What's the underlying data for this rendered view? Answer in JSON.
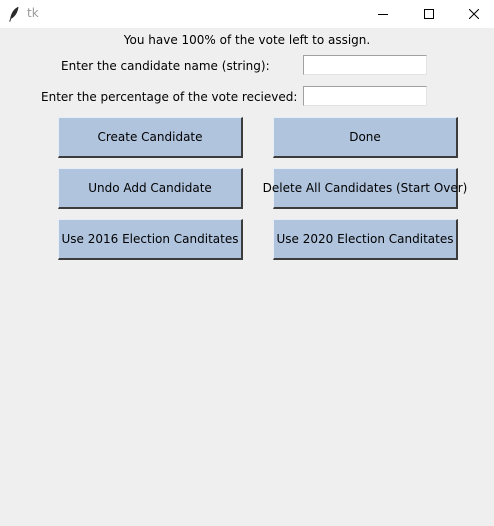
{
  "window": {
    "title": "tk"
  },
  "status": {
    "text": "You have 100% of the vote left to assign."
  },
  "form": {
    "name_label": "Enter the candidate name (string):",
    "name_value": "",
    "percent_label": "Enter the percentage of the vote recieved:",
    "percent_value": ""
  },
  "buttons": {
    "create": "Create Candidate",
    "done": "Done",
    "undo": "Undo Add Candidate",
    "delete_all": "Delete All Candidates (Start Over)",
    "use_2016": "Use 2016 Election Canditates",
    "use_2020": "Use 2020 Election Canditates"
  },
  "colors": {
    "button_bg": "#b0c4de",
    "window_bg": "#f0f0f0"
  },
  "icons": {
    "app": "feather-icon",
    "minimize": "minimize-icon",
    "maximize": "maximize-icon",
    "close": "close-icon"
  }
}
